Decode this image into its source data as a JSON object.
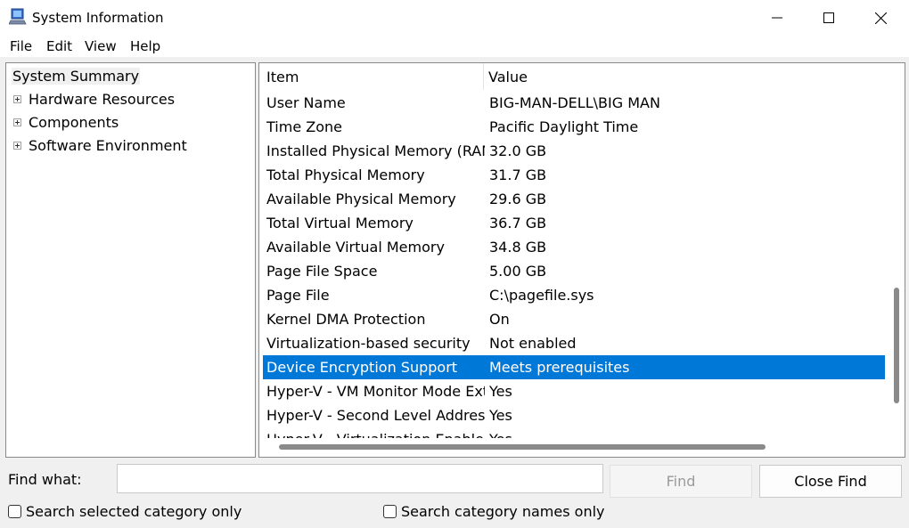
{
  "window": {
    "title": "System Information",
    "icon": "system-info-app-icon",
    "controls": [
      "minimize-icon",
      "maximize-icon",
      "close-icon"
    ]
  },
  "menu": {
    "file": "File",
    "edit": "Edit",
    "view": "View",
    "help": "Help"
  },
  "tree": {
    "root": "System Summary",
    "children": [
      "Hardware Resources",
      "Components",
      "Software Environment"
    ]
  },
  "list": {
    "columns": {
      "item": "Item",
      "value": "Value"
    },
    "rows": [
      {
        "item": "User Name",
        "value": "BIG-MAN-DELL\\BIG MAN"
      },
      {
        "item": "Time Zone",
        "value": "Pacific Daylight Time"
      },
      {
        "item": "Installed Physical Memory (RAM)",
        "value": "32.0 GB"
      },
      {
        "item": "Total Physical Memory",
        "value": "31.7 GB"
      },
      {
        "item": "Available Physical Memory",
        "value": "29.6 GB"
      },
      {
        "item": "Total Virtual Memory",
        "value": "36.7 GB"
      },
      {
        "item": "Available Virtual Memory",
        "value": "34.8 GB"
      },
      {
        "item": "Page File Space",
        "value": "5.00 GB"
      },
      {
        "item": "Page File",
        "value": "C:\\pagefile.sys"
      },
      {
        "item": "Kernel DMA Protection",
        "value": "On"
      },
      {
        "item": "Virtualization-based security",
        "value": "Not enabled"
      },
      {
        "item": "Device Encryption Support",
        "value": "Meets prerequisites"
      },
      {
        "item": "Hyper-V - VM Monitor Mode Extensions",
        "value": "Yes"
      },
      {
        "item": "Hyper-V - Second Level Address Translation Extensions",
        "value": "Yes"
      },
      {
        "item": "Hyper-V - Virtualization Enabled in Firmware",
        "value": "Yes"
      }
    ],
    "selected_item": "Device Encryption Support"
  },
  "find": {
    "label": "Find what:",
    "value": "",
    "find_button": "Find",
    "close_button": "Close Find",
    "option_selected_category": "Search selected category only",
    "option_category_names": "Search category names only"
  },
  "colors": {
    "selection": "#0078d7",
    "pane_border": "#8a8a8a",
    "window_bg": "#f0f0f0"
  }
}
